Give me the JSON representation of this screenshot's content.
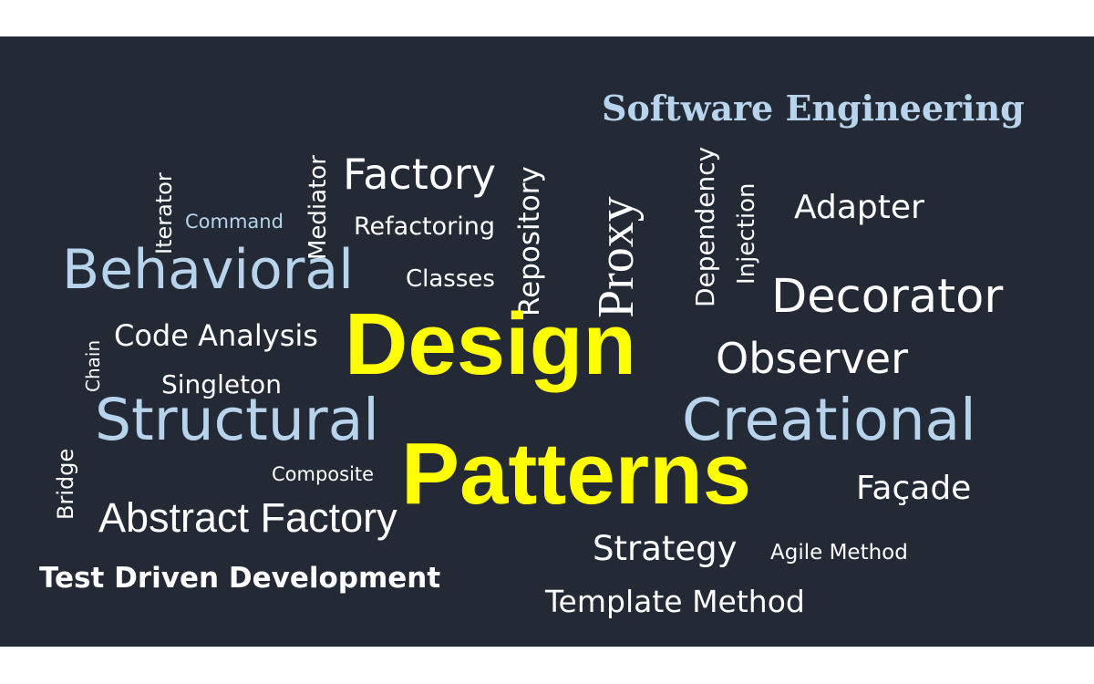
{
  "word_cloud": {
    "background_color": "#232935",
    "accent_colors": {
      "primary": "#ffff00",
      "secondary": "#b7d4ec",
      "default": "#ffffff"
    },
    "words": {
      "software_engineering": "Software Engineering",
      "factory": "Factory",
      "iterator": "Iterator",
      "command": "Command",
      "mediator": "Mediator",
      "refactoring": "Refactoring",
      "repository": "Repository",
      "proxy": "Proxy",
      "dependency": "Dependency",
      "injection": "Injection",
      "adapter": "Adapter",
      "behavioral": "Behavioral",
      "classes": "Classes",
      "decorator": "Decorator",
      "chain": "Chain",
      "code_analysis": "Code Analysis",
      "design": "Design",
      "observer": "Observer",
      "singleton": "Singleton",
      "structural": "Structural",
      "creational": "Creational",
      "bridge": "Bridge",
      "composite": "Composite",
      "patterns": "Patterns",
      "facade": "Façade",
      "abstract_factory": "Abstract Factory",
      "strategy": "Strategy",
      "agile_method": "Agile Method",
      "test_driven_development": "Test Driven Development",
      "template_method": "Template Method"
    }
  }
}
